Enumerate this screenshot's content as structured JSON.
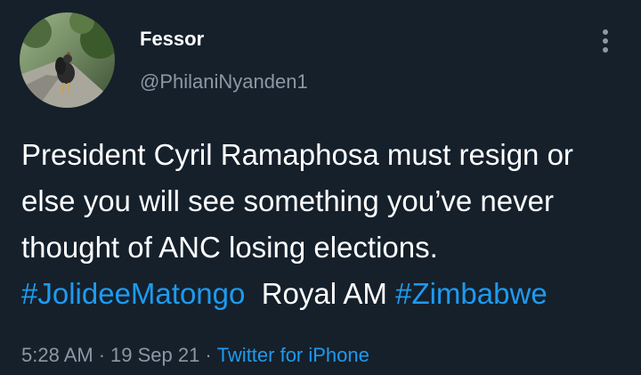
{
  "author": {
    "display_name": "Fessor",
    "handle": "@PhilaniNyanden1"
  },
  "tweet": {
    "text_part1": "President Cyril Ramaphosa must resign or else you will see something you’ve never thought of ANC losing elections.",
    "hashtag1": "#JolideeMatongo",
    "text_part2": "Royal AM",
    "hashtag2": "#Zimbabwe"
  },
  "meta": {
    "time": "5:28 AM",
    "separator": "·",
    "date": "19 Sep 21",
    "source": "Twitter for iPhone"
  },
  "icons": {
    "more": "more-vertical-icon",
    "avatar": "rooster-photo"
  },
  "colors": {
    "background": "#15202b",
    "text": "#ffffff",
    "secondary": "#8b98a5",
    "link": "#1d9bf0"
  }
}
